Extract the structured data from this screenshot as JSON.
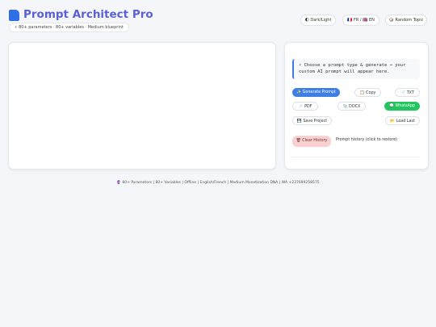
{
  "header": {
    "title": "Prompt Architect Pro",
    "stats": "⚡ 80+ parameters · 80+ variables · Medium blueprint"
  },
  "toolbar": {
    "dark_light": "🌓 Dark/Light",
    "language": "🇫🇷 FR / 🇬🇧 EN",
    "random_topic": "🎲 Random Topic"
  },
  "output": {
    "line1": "⚡ Choose a prompt type & generate → your",
    "line2": "custom AI prompt will appear here."
  },
  "actions": {
    "generate": "✨ Generate Prompt",
    "copy": "📋 Copy",
    "txt": "📄 TXT",
    "pdf": "📄 PDF",
    "docx": "📎 DOCX",
    "whatsapp": "💬 WhatsApp",
    "save": "💾 Save Project",
    "load": "📂 Load Last",
    "clear_history": "🗑 Clear History",
    "history_label": "Prompt history (click to restore)"
  },
  "footer": {
    "text": "🔮 80+ Parameters | 80+ Variables | Offline | English/French | Medium Monetization DNA | WA +237699258575"
  },
  "colors": {
    "accent": "#5a61d6",
    "primary": "#3d7fe6",
    "whatsapp": "#22c55e",
    "danger_bg": "#f8d2d2"
  }
}
